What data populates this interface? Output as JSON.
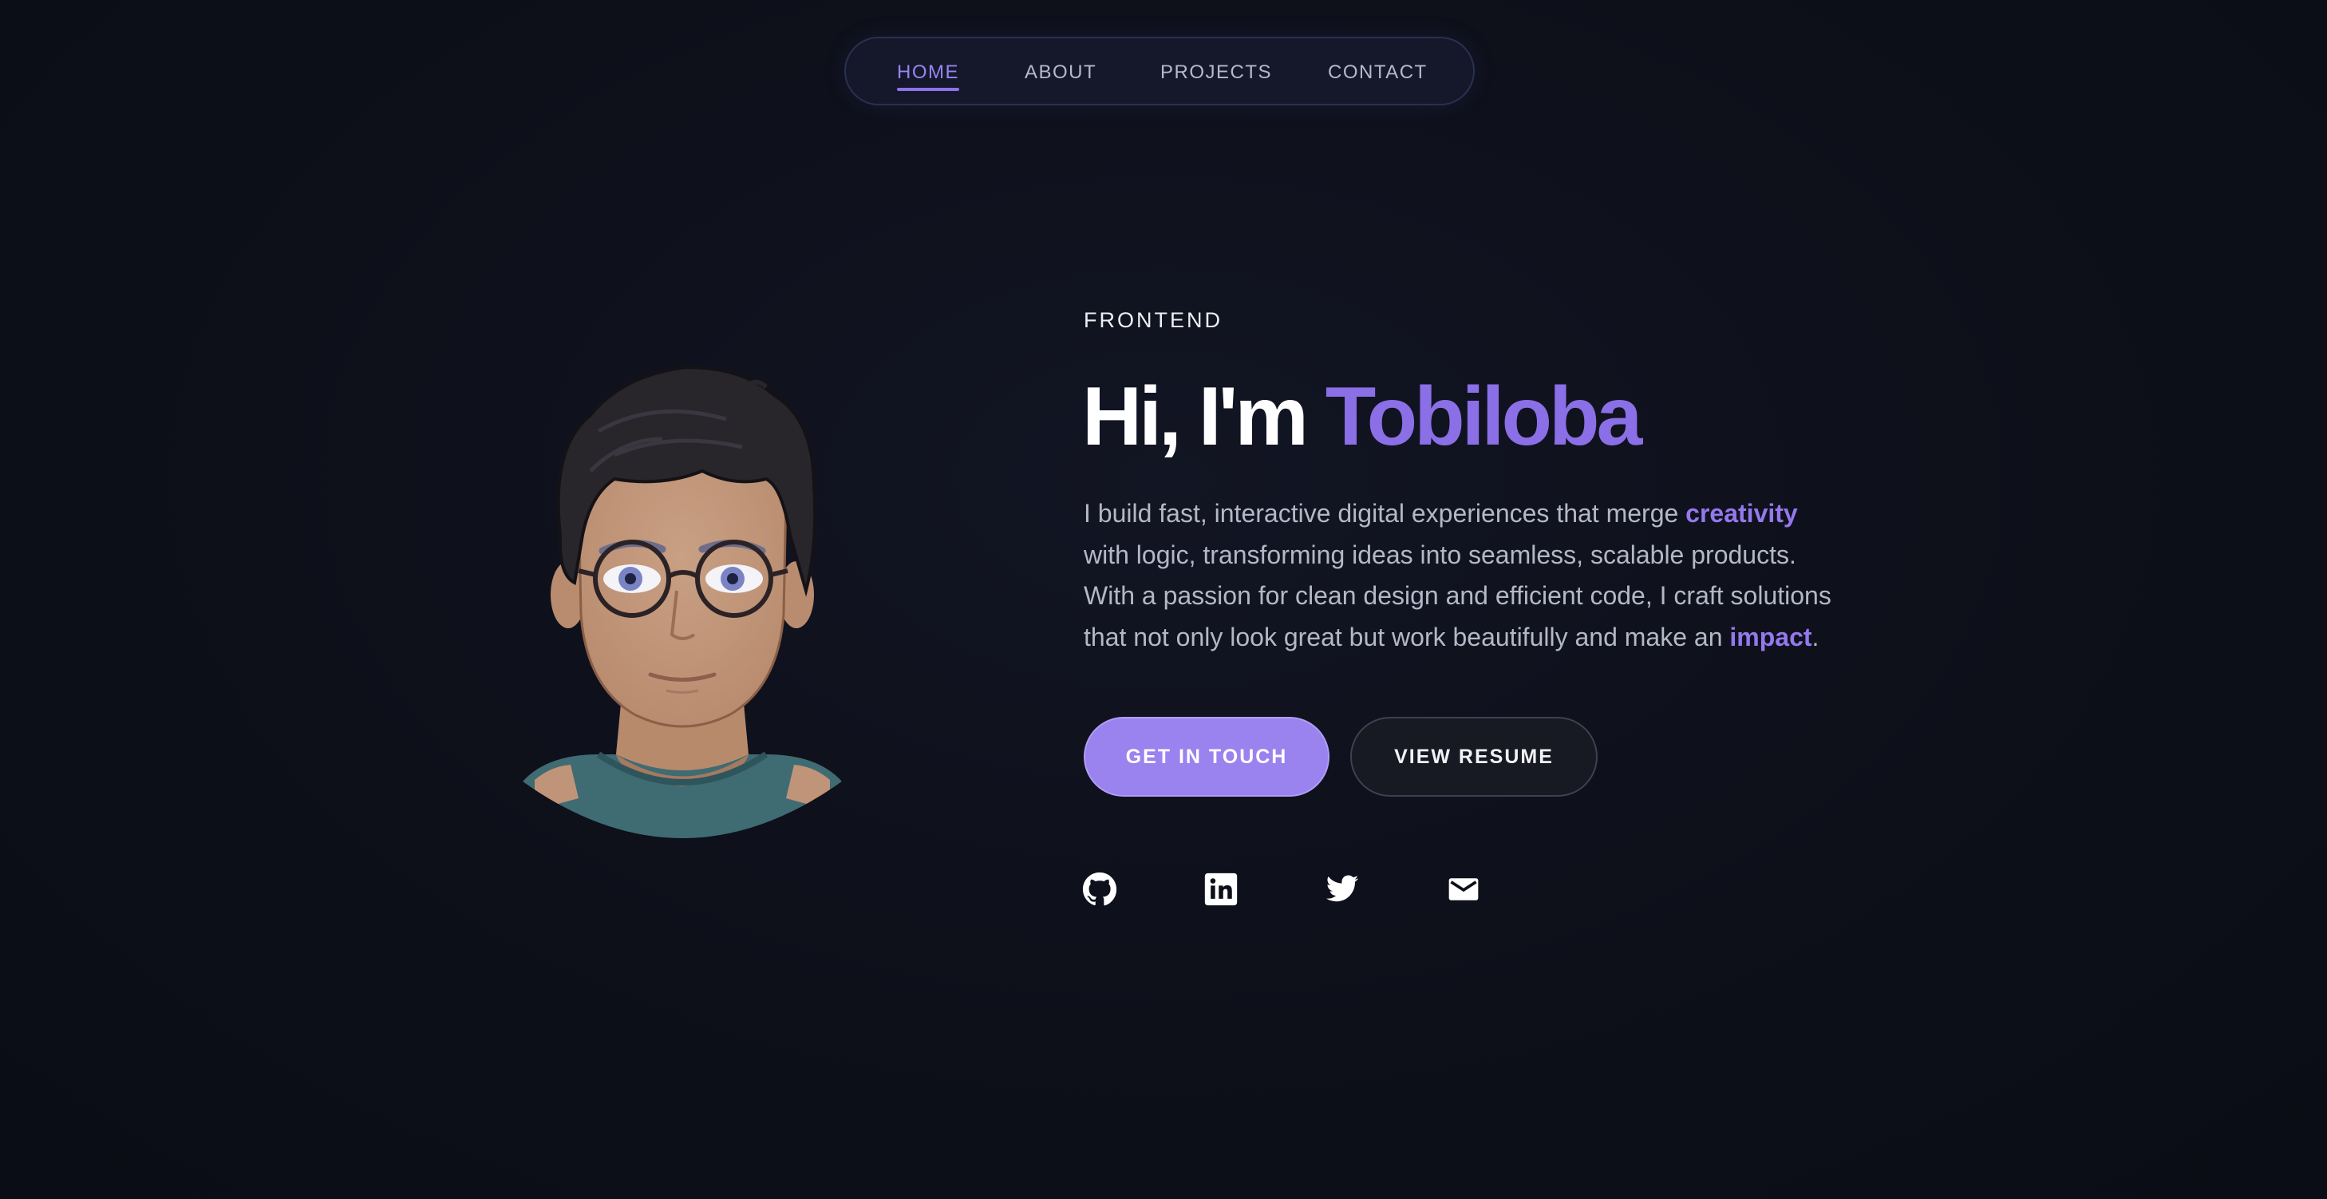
{
  "nav": {
    "items": [
      {
        "label": "HOME",
        "active": true
      },
      {
        "label": "ABOUT",
        "active": false
      },
      {
        "label": "PROJECTS",
        "active": false
      },
      {
        "label": "CONTACT",
        "active": false
      }
    ]
  },
  "hero": {
    "eyebrow": "FRONTEND",
    "greeting": "Hi, I'm",
    "name": "Tobiloba",
    "bio": {
      "line1_a": "I build fast, interactive digital experiences that merge",
      "line1_highlight": "creativity",
      "line2": "with logic, transforming ideas into seamless, scalable products.",
      "line3": "With a passion for clean design and efficient code, I craft solutions",
      "line4_a": "that not only look great but work beautifully and make an",
      "line4_highlight": "impact",
      "line4_end": "."
    },
    "buttons": {
      "primary": "GET IN TOUCH",
      "secondary": "VIEW RESUME"
    }
  },
  "social": [
    {
      "icon": "github-icon"
    },
    {
      "icon": "linkedin-icon"
    },
    {
      "icon": "twitter-icon"
    },
    {
      "icon": "mail-icon"
    }
  ],
  "colors": {
    "background": "#0d0f19",
    "accent": "#8b6fe6",
    "button_primary": "#9a82ef",
    "text_muted": "#b4b7c6"
  }
}
